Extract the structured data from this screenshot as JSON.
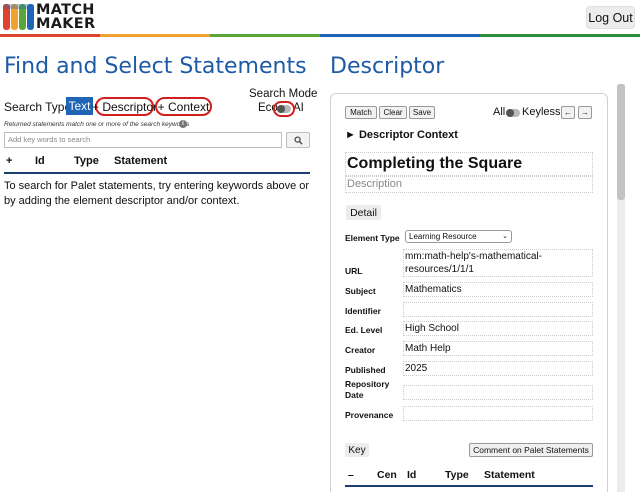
{
  "app": {
    "logo_line1": "MATCH",
    "logo_line2": "MAKER",
    "logout_label": "Log Out",
    "brand_colors": [
      "#e0432c",
      "#f0a22e",
      "#5aa63a",
      "#1f64b5",
      "#2e8c3d"
    ]
  },
  "left": {
    "title": "Find and Select Statements",
    "search_type_label": "Search Type:",
    "type_text": "Text",
    "type_descriptor": "+ Descriptor",
    "type_context": "+ Context",
    "search_mode_label": "Search Mode",
    "mode_eco": "Eco",
    "mode_ai": "AI",
    "hint": "Returned statements match one or more of the search keywords",
    "info_icon": "i",
    "search_placeholder": "Add key words to search",
    "table_headers": [
      "+",
      "Id",
      "Type",
      "Statement"
    ],
    "help_text": "To search for Palet statements, try entering keywords above or by adding the element descriptor and/or context."
  },
  "right": {
    "title": "Descriptor",
    "toolbar": {
      "match": "Match",
      "clear": "Clear",
      "save": "Save",
      "all": "All",
      "keyless": "Keyless"
    },
    "context_label": "► Descriptor Context",
    "descriptor_title": "Completing the Square",
    "description_placeholder": "Description",
    "detail_label": "Detail",
    "element_type_label": "Element Type",
    "element_type_value": "Learning Resource",
    "fields": {
      "url": {
        "label": "URL",
        "value": "mm:math-help's-mathematical-resources/1/1/1"
      },
      "subject": {
        "label": "Subject",
        "value": "Mathematics"
      },
      "identifier": {
        "label": "Identifier",
        "value": ""
      },
      "ed_level": {
        "label": "Ed. Level",
        "value": "High School"
      },
      "creator": {
        "label": "Creator",
        "value": "Math Help"
      },
      "published": {
        "label": "Published",
        "value": "2025"
      },
      "repository_date": {
        "label_line1": "Repository",
        "label_line2": "Date",
        "value": ""
      },
      "provenance": {
        "label": "Provenance",
        "value": ""
      }
    },
    "key_label": "Key",
    "comment_label": "Comment on Palet Statements",
    "table_headers": [
      "–",
      "Cen",
      "Id",
      "Type",
      "Statement"
    ]
  }
}
